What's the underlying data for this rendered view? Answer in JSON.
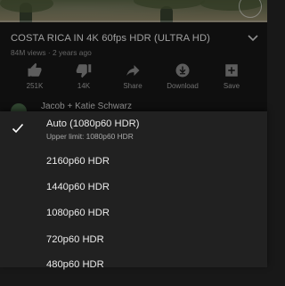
{
  "video": {
    "title": "COSTA RICA IN 4K 60fps HDR (ULTRA HD)",
    "meta": "84M views · 2 years ago",
    "progress_fraction": 0.0,
    "progress_color": "#ff0000"
  },
  "actions": [
    {
      "icon": "thumbs-up-icon",
      "label": "251K"
    },
    {
      "icon": "thumbs-down-icon",
      "label": "14K"
    },
    {
      "icon": "share-icon",
      "label": "Share"
    },
    {
      "icon": "download-icon",
      "label": "Download"
    },
    {
      "icon": "save-to-playlist-icon",
      "label": "Save"
    }
  ],
  "uploader": {
    "name": "Jacob + Katie Schwarz"
  },
  "quality_menu": {
    "selected": "Auto (1080p60 HDR)",
    "options": [
      {
        "label": "Auto (1080p60 HDR)",
        "sublabel": "Upper limit: 1080p60 HDR",
        "checked": true
      },
      {
        "label": "2160p60 HDR",
        "sublabel": "",
        "checked": false
      },
      {
        "label": "1440p60 HDR",
        "sublabel": "",
        "checked": false
      },
      {
        "label": "1080p60 HDR",
        "sublabel": "",
        "checked": false
      },
      {
        "label": "720p60 HDR",
        "sublabel": "",
        "checked": false
      },
      {
        "label": "480p60 HDR",
        "sublabel": "",
        "checked": false
      }
    ]
  },
  "colors": {
    "background": "#181818",
    "sheet": "#212121",
    "accent": "#ff0000"
  }
}
